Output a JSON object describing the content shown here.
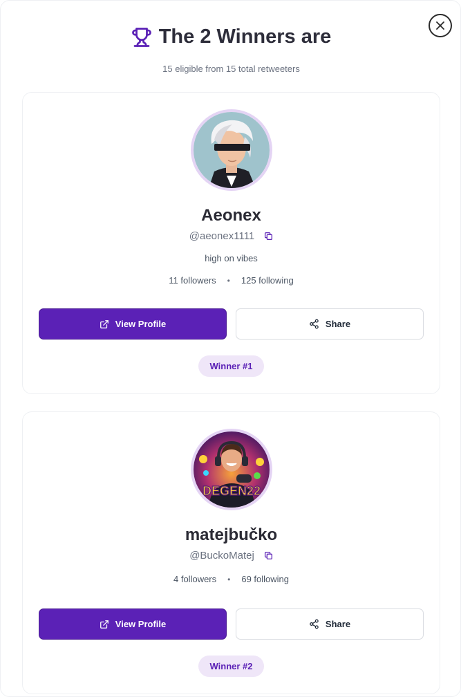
{
  "modal": {
    "title": "The 2 Winners are",
    "subtitle": "15 eligible from 15 total retweeters",
    "close_icon": "close-icon",
    "title_icon": "trophy-icon",
    "accent_color": "#5b21b6"
  },
  "winners": [
    {
      "name": "Aeonex",
      "handle": "@aeonex1111",
      "bio": "high on vibes",
      "followers": "11 followers",
      "following": "125 following",
      "separator": "•",
      "view_label": "View Profile",
      "share_label": "Share",
      "badge": "Winner #1",
      "avatar_icon": "blindfolded-character-avatar"
    },
    {
      "name": "matejbučko",
      "handle": "@BuckoMatej",
      "followers": "4 followers",
      "following": "69 following",
      "separator": "•",
      "view_label": "View Profile",
      "share_label": "Share",
      "badge": "Winner #2",
      "avatar_icon": "degen22-gamer-avatar",
      "avatar_text": "DEGEN22"
    }
  ]
}
